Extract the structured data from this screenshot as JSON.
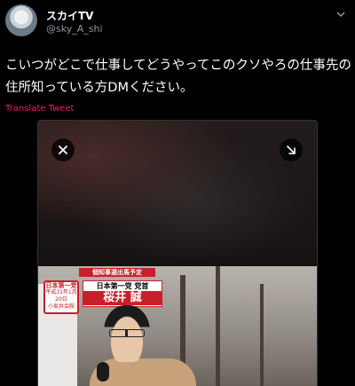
{
  "header": {
    "display_name": "スカイTV",
    "handle": "@sky_A_shi",
    "avatar_icon": "avatar-image",
    "menu_icon": "chevron-down-icon"
  },
  "tweet": {
    "line1": "こいつがどこで仕事してどうやってこのクソやろの仕事先の",
    "line2": "住所知っている方DMください。",
    "translate_label": "Translate Tweet"
  },
  "media": {
    "close_icon": "close-icon",
    "expand_icon": "expand-icon",
    "banner_text": "個知事選出馬予定",
    "sign_title": "日本第一党",
    "sign_line1": "平成31年1月20日",
    "sign_line2": "小坂井会館",
    "name_party": "日本第一党 党首",
    "name_person": "桜井 誠"
  },
  "colors": {
    "background": "#000000",
    "text": "#ffffff",
    "secondary": "#8b98a5",
    "translate_link": "#e0245e",
    "party_red": "#c8202a"
  }
}
